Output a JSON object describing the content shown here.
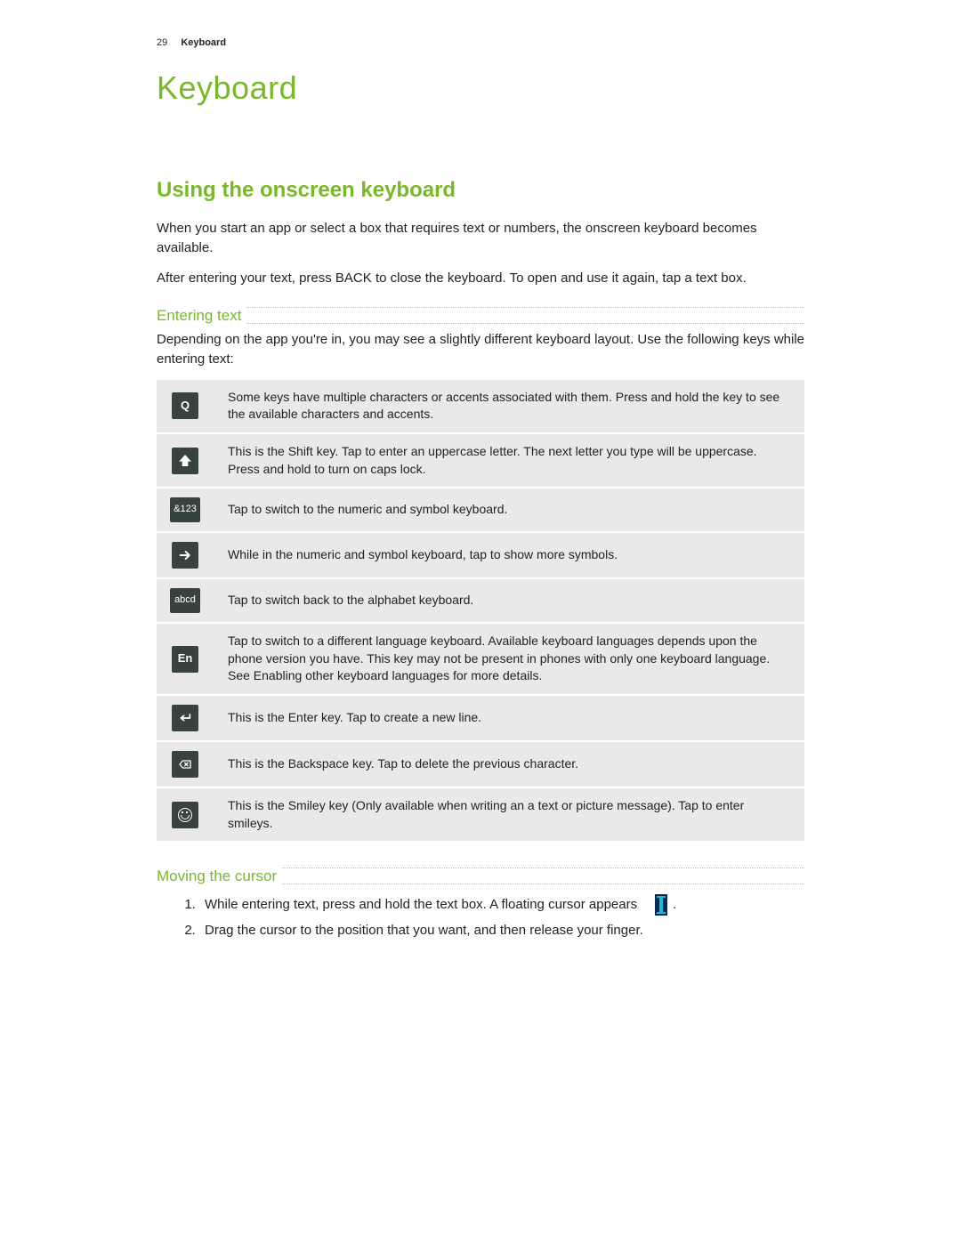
{
  "header": {
    "page_number": "29",
    "breadcrumb_plain": "Keyboard",
    "breadcrumb_overlay": "Keyboard"
  },
  "chapter_title": "Keyboard",
  "section_title": "Using the onscreen keyboard",
  "intro_p1": "When you start an app or select a box that requires text or numbers, the onscreen keyboard becomes available.",
  "intro_p2": "After entering your text, press BACK to close the keyboard. To open and use it again, tap a text box.",
  "sub_entering": "Entering text",
  "entering_p": "Depending on the app you're in, you may see a slightly different keyboard layout. Use the following keys while entering text:",
  "keys": [
    {
      "label": "Q",
      "type": "text",
      "desc": "Some keys have multiple characters or accents associated with them. Press and hold the key to see the available characters and accents."
    },
    {
      "label": "shift",
      "type": "icon",
      "desc": "This is the Shift key. Tap to enter an uppercase letter. The next letter you type will be uppercase. Press and hold to turn on caps lock."
    },
    {
      "label": "&123",
      "type": "text-small",
      "desc": "Tap to switch to the numeric and symbol keyboard."
    },
    {
      "label": "arrow-right",
      "type": "icon",
      "desc": "While in the numeric and symbol keyboard, tap to show more symbols."
    },
    {
      "label": "abcd",
      "type": "text-small",
      "desc": "Tap to switch back to the alphabet keyboard."
    },
    {
      "label": "En",
      "type": "text",
      "desc": "Tap to switch to a different language keyboard. Available keyboard languages depends upon the phone version you have. This key may not be present in phones with only one keyboard language. See Enabling other keyboard languages for more details."
    },
    {
      "label": "enter",
      "type": "icon",
      "desc": "This is the Enter key. Tap to create a new line."
    },
    {
      "label": "backspace",
      "type": "icon",
      "desc": "This is the Backspace key. Tap to delete the previous character."
    },
    {
      "label": "smiley",
      "type": "smiley",
      "desc": "This is the Smiley key (Only available when writing an a text or picture message). Tap to enter smileys."
    }
  ],
  "sub_moving": "Moving the cursor",
  "steps": [
    "While entering text, press and hold the text box. A floating cursor appears",
    "Drag the cursor to the position that you want, and then release your finger."
  ],
  "step1_trailing_period": "."
}
